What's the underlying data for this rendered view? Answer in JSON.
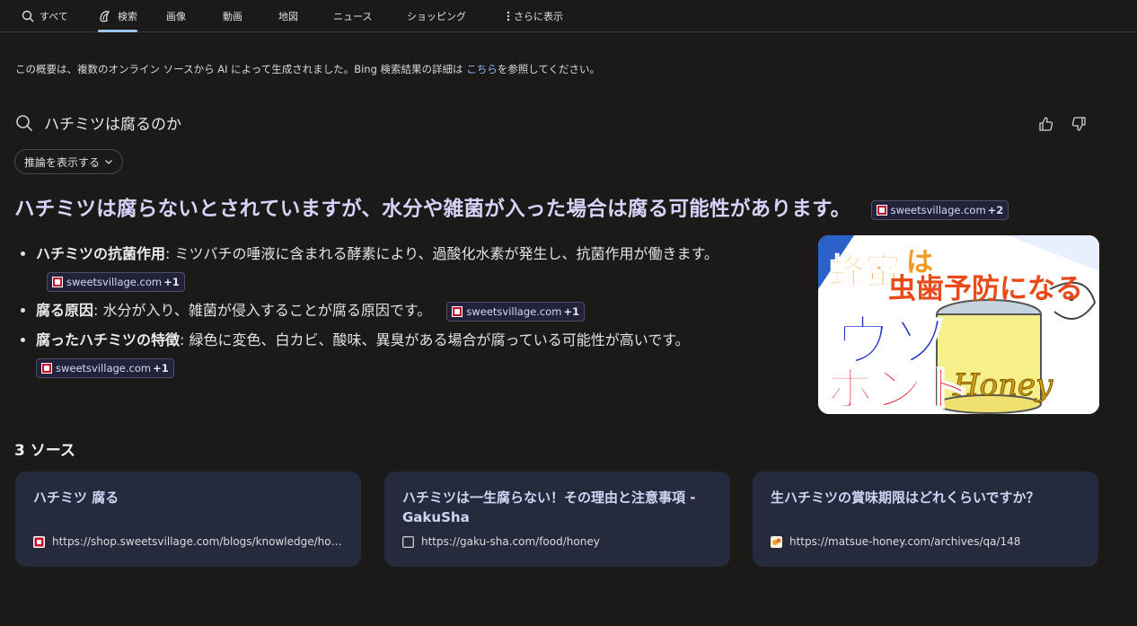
{
  "nav": {
    "items": [
      {
        "label": "すべて",
        "icon": "search-icon"
      },
      {
        "label": "検索",
        "icon": "copilot-icon",
        "active": true
      },
      {
        "label": "画像"
      },
      {
        "label": "動画"
      },
      {
        "label": "地図"
      },
      {
        "label": "ニュース"
      },
      {
        "label": "ショッピング"
      },
      {
        "label": "さらに表示",
        "icon": "more-vertical-icon"
      }
    ]
  },
  "disclaimer": {
    "before": "この概要は、複数のオンライン ソースから AI によって生成されました。Bing 検索結果の詳細は ",
    "link": "こちら",
    "after": "を参照してください。"
  },
  "query": "ハチミツは腐るのか",
  "reasoning_button": "推論を表示する",
  "headline": "ハチミツは腐らないとされていますが、水分や雑菌が入った場合は腐る可能性があります。",
  "headline_cite": {
    "domain": "sweetsvillage.com",
    "more": "+2"
  },
  "bullets": [
    {
      "term": "ハチミツの抗菌作用",
      "text": ": ミツバチの唾液に含まれる酵素により、過酸化水素が発生し、抗菌作用が働きます。",
      "cite": {
        "domain": "sweetsvillage.com",
        "more": "+1"
      }
    },
    {
      "term": "腐る原因",
      "text": ": 水分が入り、雑菌が侵入することが腐る原因です。",
      "cite": {
        "domain": "sweetsvillage.com",
        "more": "+1"
      }
    },
    {
      "term": "腐ったハチミツの特徴",
      "text": ": 緑色に変色、白カビ、酸味、異臭がある場合が腐っている可能性が高いです。",
      "cite": {
        "domain": "sweetsvillage.com",
        "more": "+1"
      }
    }
  ],
  "hero_image": {
    "line1_a": "蜂蜜",
    "line1_b": "は",
    "line2": "虫歯予防になる",
    "line3": "ウソ",
    "line4": "ホント",
    "jar_label": "Honey"
  },
  "sources": {
    "title": "3 ソース",
    "cards": [
      {
        "title": "ハチミツ 腐る",
        "url": "https://shop.sweetsvillage.com/blogs/knowledge/honey-rot",
        "favicon": "sweetsvillage-favicon"
      },
      {
        "title": "ハチミツは一生腐らない！その理由と注意事項 - GakuSha",
        "url": "https://gaku-sha.com/food/honey",
        "favicon": "gakusha-favicon"
      },
      {
        "title": "生ハチミツの賞味期限はどれくらいですか？",
        "url": "https://matsue-honey.com/archives/qa/148",
        "favicon": "matsue-honey-favicon"
      }
    ]
  },
  "colors": {
    "background": "#1b1a19",
    "accent_link": "#8ab8f5",
    "headline": "#d6d3f8",
    "card_bg": "#252a3c"
  }
}
